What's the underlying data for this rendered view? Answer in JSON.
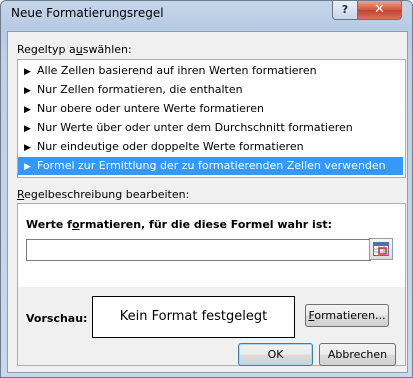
{
  "window": {
    "title": "Neue Formatierungsregel",
    "help_label": "?",
    "close_label": "✕"
  },
  "ruletype": {
    "label_pre": "Regeltyp a",
    "label_u": "u",
    "label_post": "swählen:",
    "items": [
      "Alle Zellen basierend auf ihren Werten formatieren",
      "Nur Zellen formatieren, die enthalten",
      "Nur obere oder untere Werte formatieren",
      "Nur Werte über oder unter dem Durchschnitt formatieren",
      "Nur eindeutige oder doppelte Werte formatieren",
      "Formel zur Ermittlung der zu formatierenden Zellen verwenden"
    ],
    "selected_index": 5
  },
  "description": {
    "label_pre": "",
    "label_u": "R",
    "label_post": "egelbeschreibung bearbeiten:",
    "formula_heading_pre": "Werte f",
    "formula_heading_u": "o",
    "formula_heading_post": "rmatieren, für die diese Formel wahr ist:",
    "formula_value": "",
    "preview_label": "Vorschau:",
    "preview_text": "Kein Format festgelegt",
    "format_button_u": "F",
    "format_button_post": "ormatieren..."
  },
  "footer": {
    "ok_label": "OK",
    "cancel_label": "Abbrechen"
  },
  "colors": {
    "selection": "#3399ff",
    "title_gradient": "#b8cbe4",
    "close_button": "#c2422b"
  }
}
